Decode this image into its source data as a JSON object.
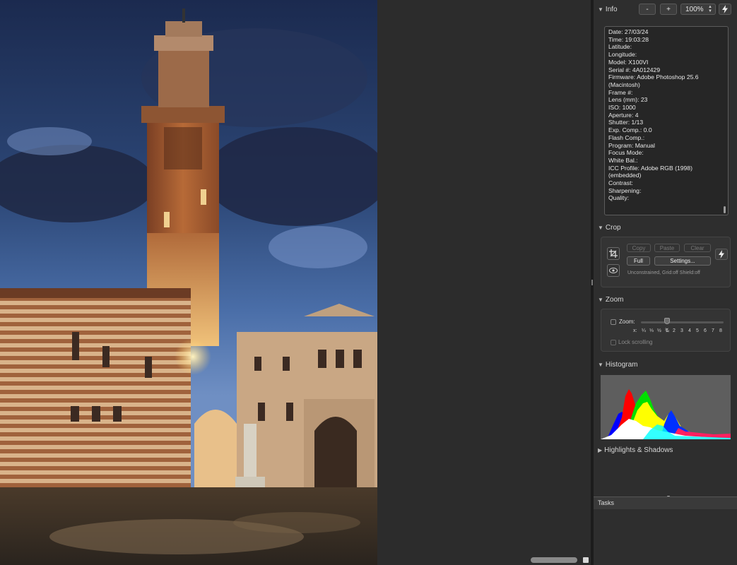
{
  "info": {
    "title": "Info",
    "zoom_out_label": "-",
    "zoom_in_label": "+",
    "zoom_value": "100%",
    "lines": [
      "Date: 27/03/24",
      "Time: 19:03:28",
      "Latitude:",
      "Longitude:",
      "Model: X100VI",
      "Serial #: 4A012429",
      "Firmware: Adobe Photoshop 25.6",
      "(Macintosh)",
      "Frame #:",
      "Lens (mm): 23",
      "ISO: 1000",
      "Aperture: 4",
      "Shutter: 1/13",
      "Exp. Comp.: 0.0",
      "Flash Comp.:",
      "Program: Manual",
      "Focus Mode:",
      "White Bal.:",
      "ICC Profile: Adobe RGB (1998)",
      "(embedded)",
      "Contrast:",
      "Sharpening:",
      "Quality:"
    ]
  },
  "crop": {
    "title": "Crop",
    "copy_label": "Copy",
    "paste_label": "Paste",
    "clear_label": "Clear",
    "full_label": "Full",
    "settings_label": "Settings...",
    "status": "Unconstrained, Grid:off Shield:off"
  },
  "zoom": {
    "title": "Zoom",
    "zoom_label": "Zoom:",
    "x_label": "x:",
    "ticks": [
      "¼",
      "⅓",
      "½",
      "¾",
      "1",
      "2",
      "3",
      "4",
      "5",
      "6",
      "7",
      "8"
    ],
    "lock_label": "Lock scrolling"
  },
  "histogram": {
    "title": "Histogram"
  },
  "highlights": {
    "title": "Highlights & Shadows"
  },
  "tasks": {
    "title": "Tasks"
  },
  "icons": {
    "info_action": "lightning-icon",
    "crop_action": "lightning-icon",
    "crop_tool": "crop-icon",
    "crop_preview": "eye-icon"
  }
}
